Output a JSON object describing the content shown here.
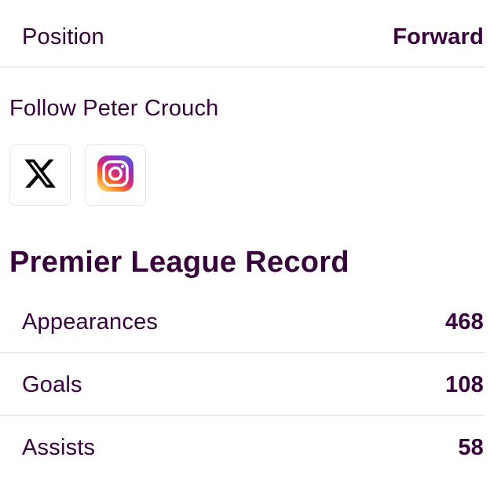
{
  "profile": {
    "position_label": "Position",
    "position_value": "Forward"
  },
  "follow": {
    "title": "Follow Peter Crouch",
    "socials": [
      {
        "name": "x-icon"
      },
      {
        "name": "instagram-icon"
      }
    ]
  },
  "record": {
    "title": "Premier League Record",
    "stats": [
      {
        "label": "Appearances",
        "value": "468"
      },
      {
        "label": "Goals",
        "value": "108"
      },
      {
        "label": "Assists",
        "value": "58"
      }
    ]
  },
  "colors": {
    "text_primary": "#37003c",
    "divider": "#ebebeb",
    "card_border": "#e7e7e7"
  }
}
